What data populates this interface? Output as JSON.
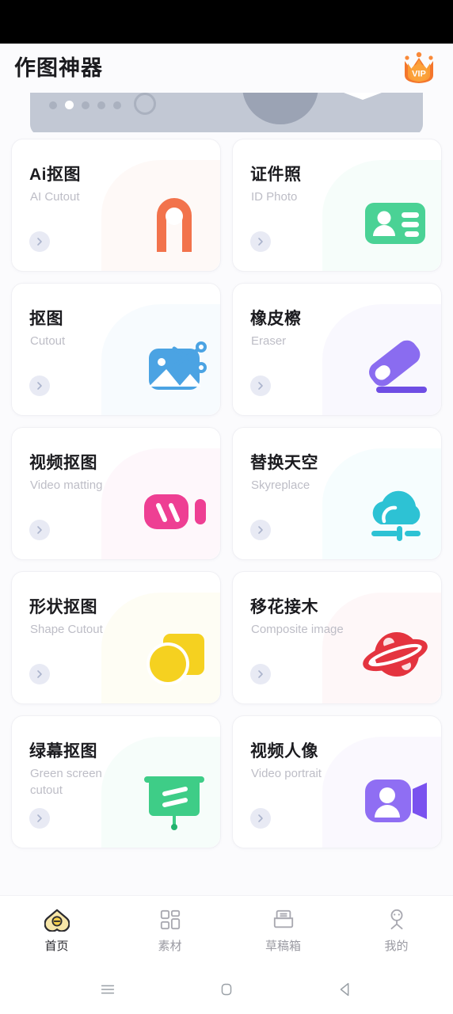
{
  "app": {
    "title": "作图神器",
    "vip_badge_label": "VIP",
    "vip_badge_color": "#f98939"
  },
  "banner": {
    "dot_count": 5,
    "active_dot_index": 1
  },
  "tools": [
    {
      "title": "Ai抠图",
      "subtitle": "AI Cutout",
      "icon": "ai-cutout-arch-icon",
      "color": "#f2734c",
      "tint": "#fdeee8"
    },
    {
      "title": "证件照",
      "subtitle": "ID Photo",
      "icon": "id-card-icon",
      "color": "#4ad295",
      "tint": "#e6faf0"
    },
    {
      "title": "抠图",
      "subtitle": "Cutout",
      "icon": "image-scissors-icon",
      "color": "#4ba3e3",
      "tint": "#e8f3fd"
    },
    {
      "title": "橡皮檫",
      "subtitle": "Eraser",
      "icon": "eraser-icon",
      "color": "#8a6cf0",
      "tint": "#efeafd"
    },
    {
      "title": "视频抠图",
      "subtitle": "Video matting",
      "icon": "video-camera-icon",
      "color": "#ee3f93",
      "tint": "#fde9f3"
    },
    {
      "title": "替换天空",
      "subtitle": "Skyreplace",
      "icon": "cloud-sky-icon",
      "color": "#2dc2d4",
      "tint": "#e4f8fb"
    },
    {
      "title": "形状抠图",
      "subtitle": "Shape Cutout",
      "icon": "shape-square-circle-icon",
      "color": "#f5d120",
      "tint": "#fdf8e0"
    },
    {
      "title": "移花接木",
      "subtitle": "Composite image",
      "icon": "planet-icon",
      "color": "#e4343f",
      "tint": "#fde9ea"
    },
    {
      "title": "绿幕抠图",
      "subtitle": "Green screen cutout",
      "icon": "green-screen-board-icon",
      "color": "#3ecd87",
      "tint": "#e6faf1"
    },
    {
      "title": "视频人像",
      "subtitle": "Video portrait",
      "icon": "person-video-icon",
      "color": "#8f6ef3",
      "tint": "#f0eafd"
    }
  ],
  "tabbar": {
    "items": [
      {
        "label": "首页",
        "icon": "home-icon",
        "active": true
      },
      {
        "label": "素材",
        "icon": "grid-blocks-icon",
        "active": false
      },
      {
        "label": "草稿箱",
        "icon": "drafts-tray-icon",
        "active": false
      },
      {
        "label": "我的",
        "icon": "person-profile-icon",
        "active": false
      }
    ]
  },
  "android_nav": {
    "recents_label": "recents",
    "home_label": "home",
    "back_label": "back"
  }
}
